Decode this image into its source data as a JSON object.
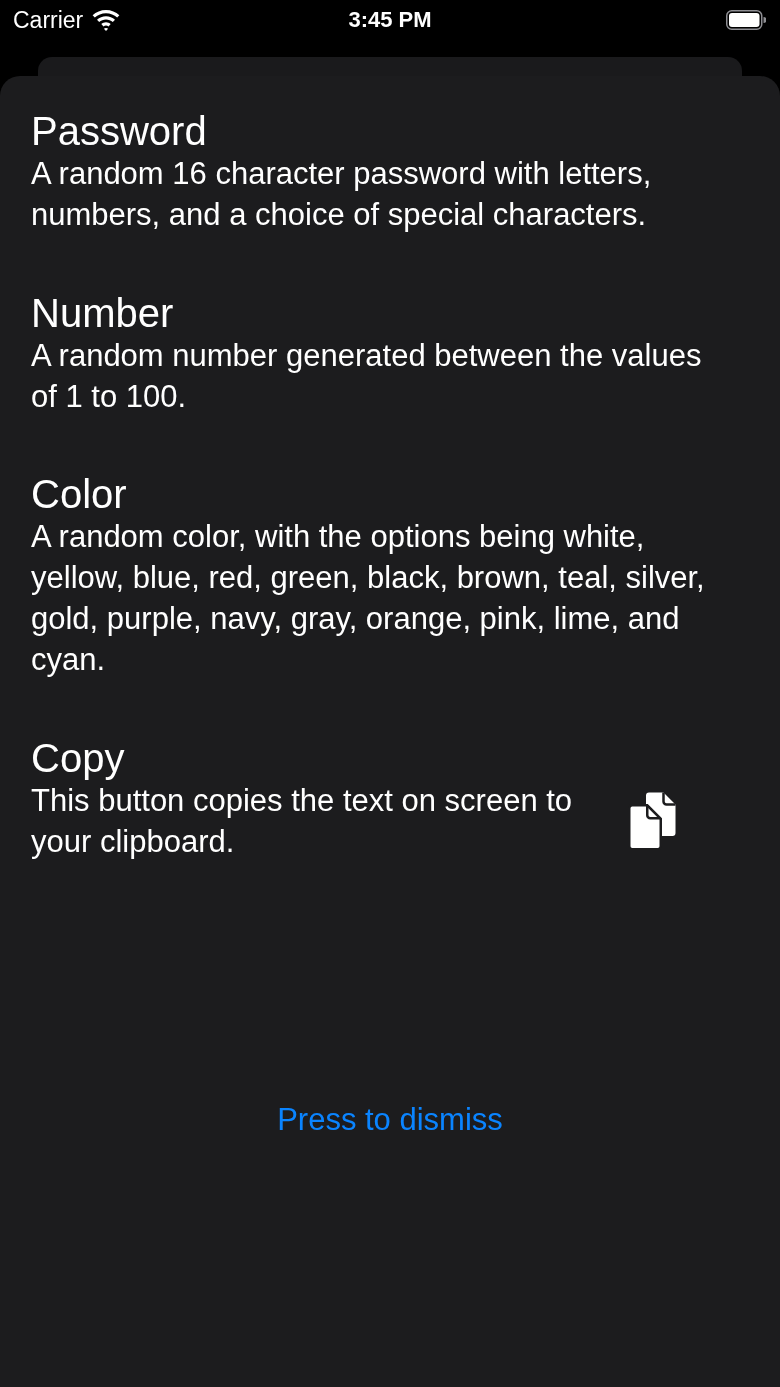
{
  "status_bar": {
    "carrier": "Carrier",
    "time": "3:45 PM"
  },
  "sections": [
    {
      "kind": "text",
      "title": "Password",
      "description": "A random 16 character password with letters, numbers, and a choice of special characters."
    },
    {
      "kind": "text",
      "title": "Number",
      "description": "A random number generated between the values of 1 to 100."
    },
    {
      "kind": "text",
      "title": "Color",
      "description": "A random color, with the options being white, yellow, blue, red, green, black, brown, teal, silver, gold, purple, navy, gray, orange, pink, lime, and cyan."
    },
    {
      "kind": "copy",
      "title": "Copy",
      "description": "This button copies the text on screen to your clipboard."
    }
  ],
  "dismiss_button": {
    "label": "Press to dismiss"
  }
}
